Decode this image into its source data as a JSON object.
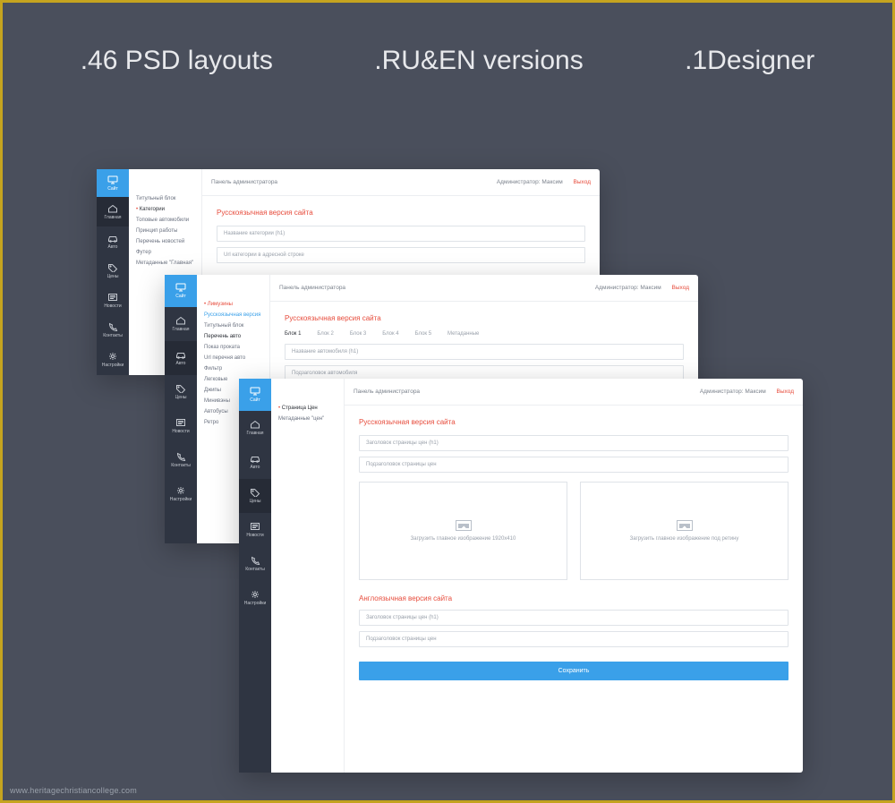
{
  "hero": {
    "a": ".46 PSD layouts",
    "b": ".RU&EN versions",
    "c": ".1Designer"
  },
  "watermark": "www.heritagechristiancollege.com",
  "common": {
    "rail_top": "Сайт",
    "topbar_title": "Панель администратора",
    "admin": "Администратор: Максим",
    "logout": "Выход",
    "section_ru": "Русскоязычная версия сайта",
    "section_en": "Англоязычная версия сайта"
  },
  "rail": [
    {
      "icon": "home",
      "label": "Главная"
    },
    {
      "icon": "car",
      "label": "Авто"
    },
    {
      "icon": "tag",
      "label": "Цены"
    },
    {
      "icon": "news",
      "label": "Новости"
    },
    {
      "icon": "phone",
      "label": "Контакты"
    },
    {
      "icon": "gear",
      "label": "Настройки"
    }
  ],
  "panel1": {
    "active_rail": 0,
    "subnav": [
      {
        "text": "Титульный блок",
        "cls": "item"
      },
      {
        "text": "Категории",
        "cls": "item strong bullet"
      },
      {
        "text": "Топовые автомобили",
        "cls": "item"
      },
      {
        "text": "Принцип работы",
        "cls": "item"
      },
      {
        "text": "Перечень новостей",
        "cls": "item"
      },
      {
        "text": "Футер",
        "cls": "item"
      },
      {
        "text": "Метаданные \"Главная\"",
        "cls": "item"
      }
    ],
    "fields": [
      "Название категории (h1)",
      "Url категории в адресной строке"
    ]
  },
  "panel2": {
    "active_rail": 1,
    "subnav_top": "Лимузины",
    "subnav": [
      {
        "text": "Русскоязычная версия",
        "cls": "item blue"
      },
      {
        "text": "Титульный блок",
        "cls": "item"
      },
      {
        "text": "Перечень авто",
        "cls": "item strong"
      },
      {
        "text": "Показ проката",
        "cls": "item"
      },
      {
        "text": "Url перечня авто",
        "cls": "item"
      },
      {
        "text": "Фильтр",
        "cls": "item"
      },
      {
        "text": "Легковые",
        "cls": "item"
      },
      {
        "text": "Джипы",
        "cls": "item"
      },
      {
        "text": "Минивэны",
        "cls": "item"
      },
      {
        "text": "Автобусы",
        "cls": "item"
      },
      {
        "text": "Ретро",
        "cls": "item"
      }
    ],
    "tabs": [
      "Блок 1",
      "Блок 2",
      "Блок 3",
      "Блок 4",
      "Блок 5",
      "Метаданные"
    ],
    "fields": [
      "Название автомобиля  (h1)",
      "Подзаголовок автомобиля"
    ]
  },
  "panel3": {
    "active_rail": 2,
    "subnav": [
      {
        "text": "Страница Цен",
        "cls": "item strong bullet"
      },
      {
        "text": "Метаданные \"цен\"",
        "cls": "item"
      }
    ],
    "fields_ru": [
      "Заголовок страницы цен (h1)",
      "Подзаголовок страницы цен"
    ],
    "upload1": "Загрузить главное изображение 1920x410",
    "upload2": "Загрузить главное изображение под ретину",
    "fields_en": [
      "Заголовок страницы цен (h1)",
      "Подзаголовок страницы цен"
    ],
    "save": "Сохранить"
  }
}
